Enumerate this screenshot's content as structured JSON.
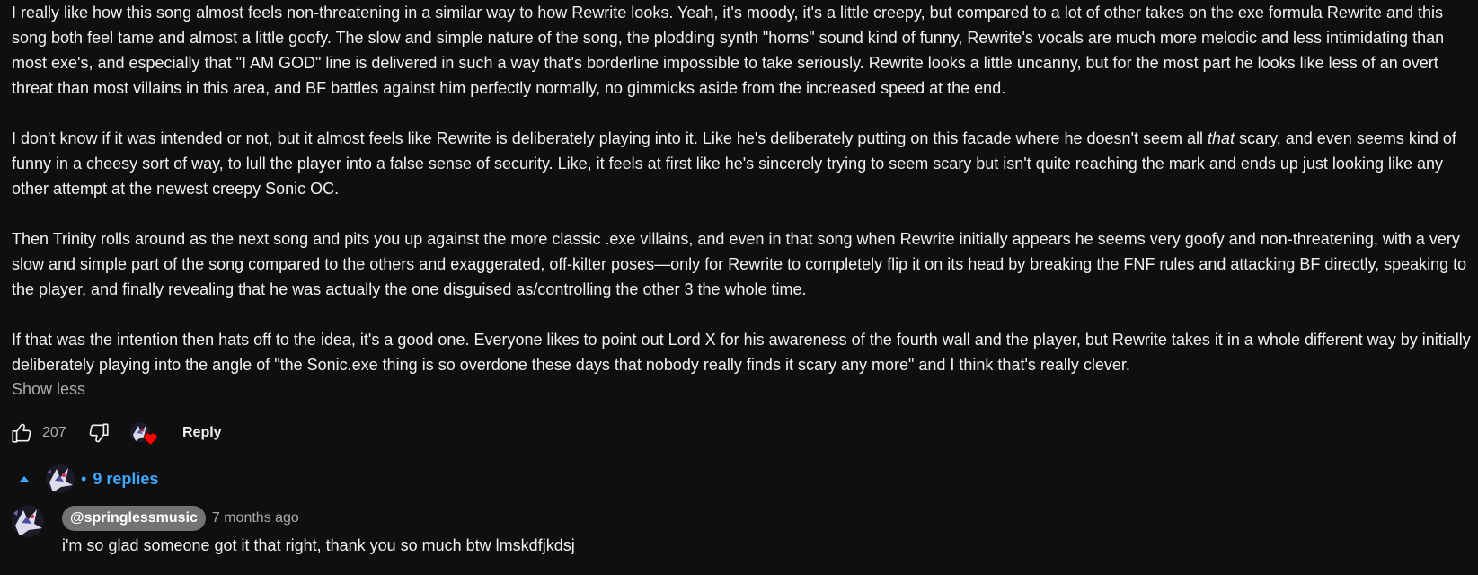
{
  "comment": {
    "paragraphs": [
      {
        "before": "I really like how this song almost feels non-threatening in a similar way to how Rewrite looks. Yeah, it's moody, it's a little creepy, but compared to a lot of other takes on the exe formula Rewrite and this song both feel tame and almost a little goofy. The slow and simple nature of the song, the plodding synth \"horns\" sound kind of funny, Rewrite's vocals are much more melodic and less intimidating than most exe's, and especially that \"I AM GOD\" line is delivered in such a way that's borderline impossible to take seriously. Rewrite looks a little uncanny, but for the most part he looks like less of an overt threat than most villains in this area, and BF battles against him perfectly normally, no gimmicks aside from the increased speed at the end."
      },
      {
        "before": "I don't know if it was intended or not, but it almost feels like Rewrite is deliberately playing into it. Like he's deliberately putting on this facade where he doesn't seem all ",
        "em": "that",
        "after": " scary, and even seems kind of funny in a cheesy sort of way, to lull the player into a false sense of security. Like, it feels at first like he's sincerely trying to seem scary but isn't quite reaching the mark and ends up just looking like any other attempt at the newest creepy Sonic OC."
      },
      {
        "before": "Then Trinity rolls around as the next song and pits you up against the more classic .exe villains, and even in that song when Rewrite initially appears he seems very goofy and non-threatening, with a very slow and simple part of the song compared to the others and exaggerated, off-kilter poses—only for Rewrite to completely flip it on its head by breaking the FNF rules and attacking BF directly, speaking to the player, and finally revealing that he was actually the one disguised as/controlling the other 3 the whole time."
      },
      {
        "before": "If that was the intention then hats off to the idea, it's a good one. Everyone likes to point out Lord X for his awareness of the fourth wall and the player, but Rewrite takes it in a whole different way by initially deliberately playing into the angle of \"the Sonic.exe thing is so overdone these days that nobody really finds it scary any more\" and I think that's really clever."
      }
    ],
    "show_less_label": "Show less",
    "like_count": "207",
    "reply_label": "Reply",
    "heart_color": "#ff0000"
  },
  "replies": {
    "count_label": "9 replies",
    "dot": "•",
    "accent_color": "#3ea6ff"
  },
  "reply": {
    "author": "@springlessmusic",
    "timestamp": "7 months ago",
    "text": "i'm so glad someone got it that right, thank you so much btw lmskdfjkdsj"
  }
}
